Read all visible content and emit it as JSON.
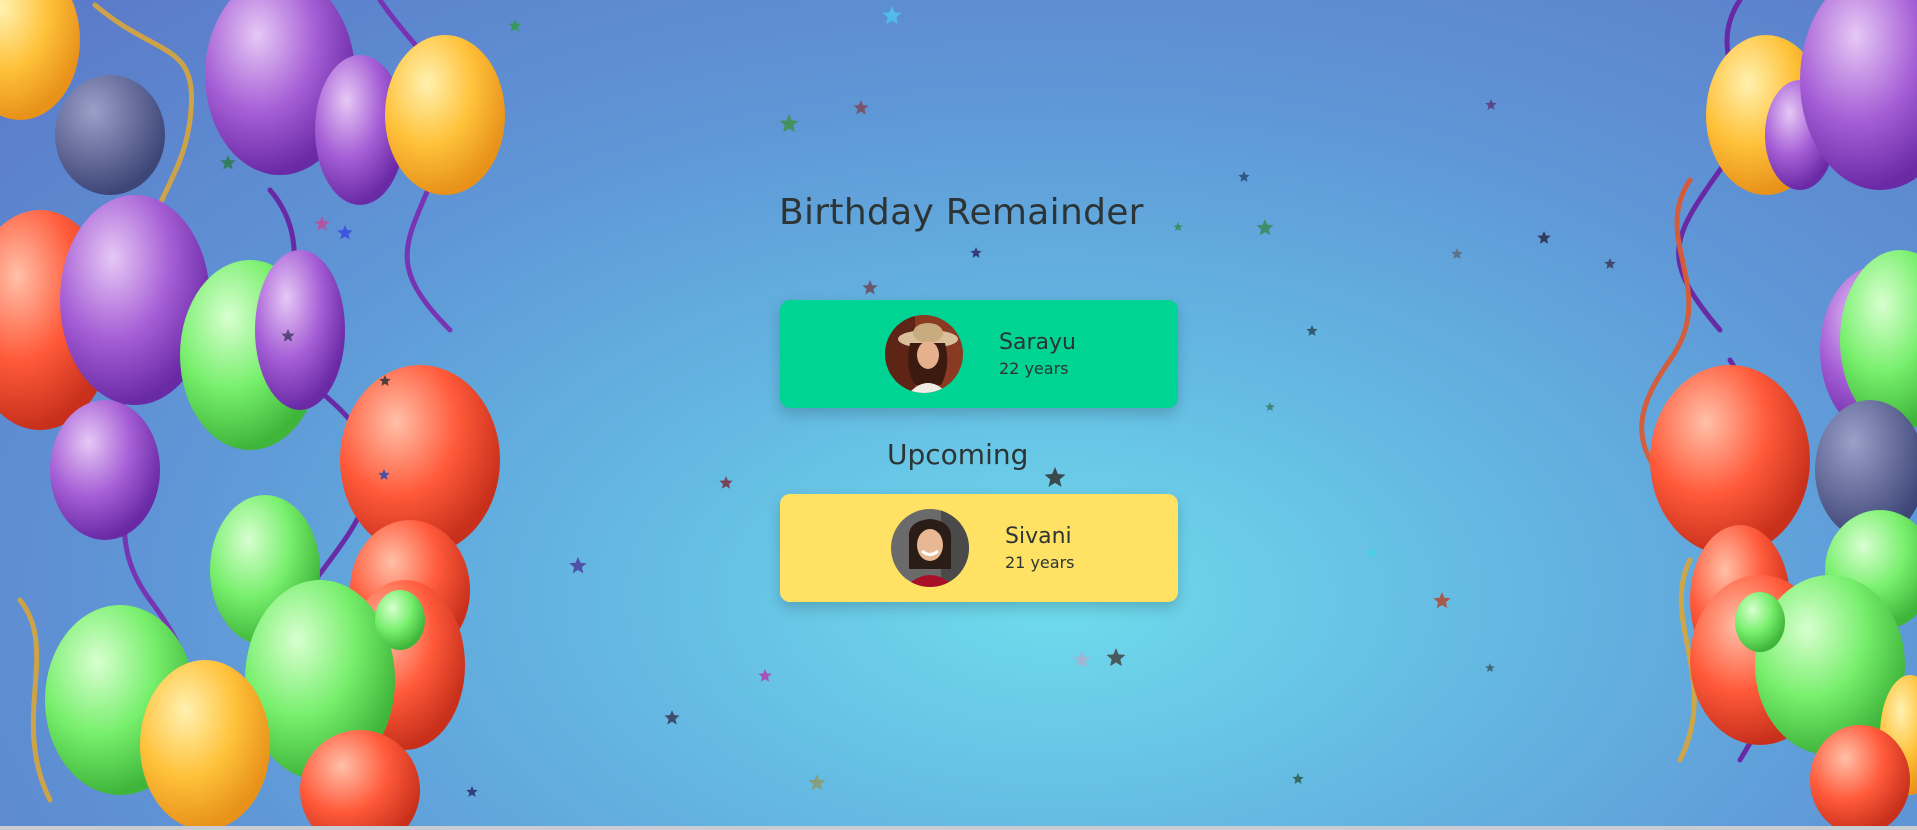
{
  "page": {
    "title": "Birthday Remainder",
    "upcoming_heading": "Upcoming"
  },
  "today": {
    "name": "Sarayu",
    "age": "22 years",
    "color": "#00d494"
  },
  "upcoming": {
    "name": "Sivani",
    "age": "21 years",
    "color": "#ffe264"
  }
}
